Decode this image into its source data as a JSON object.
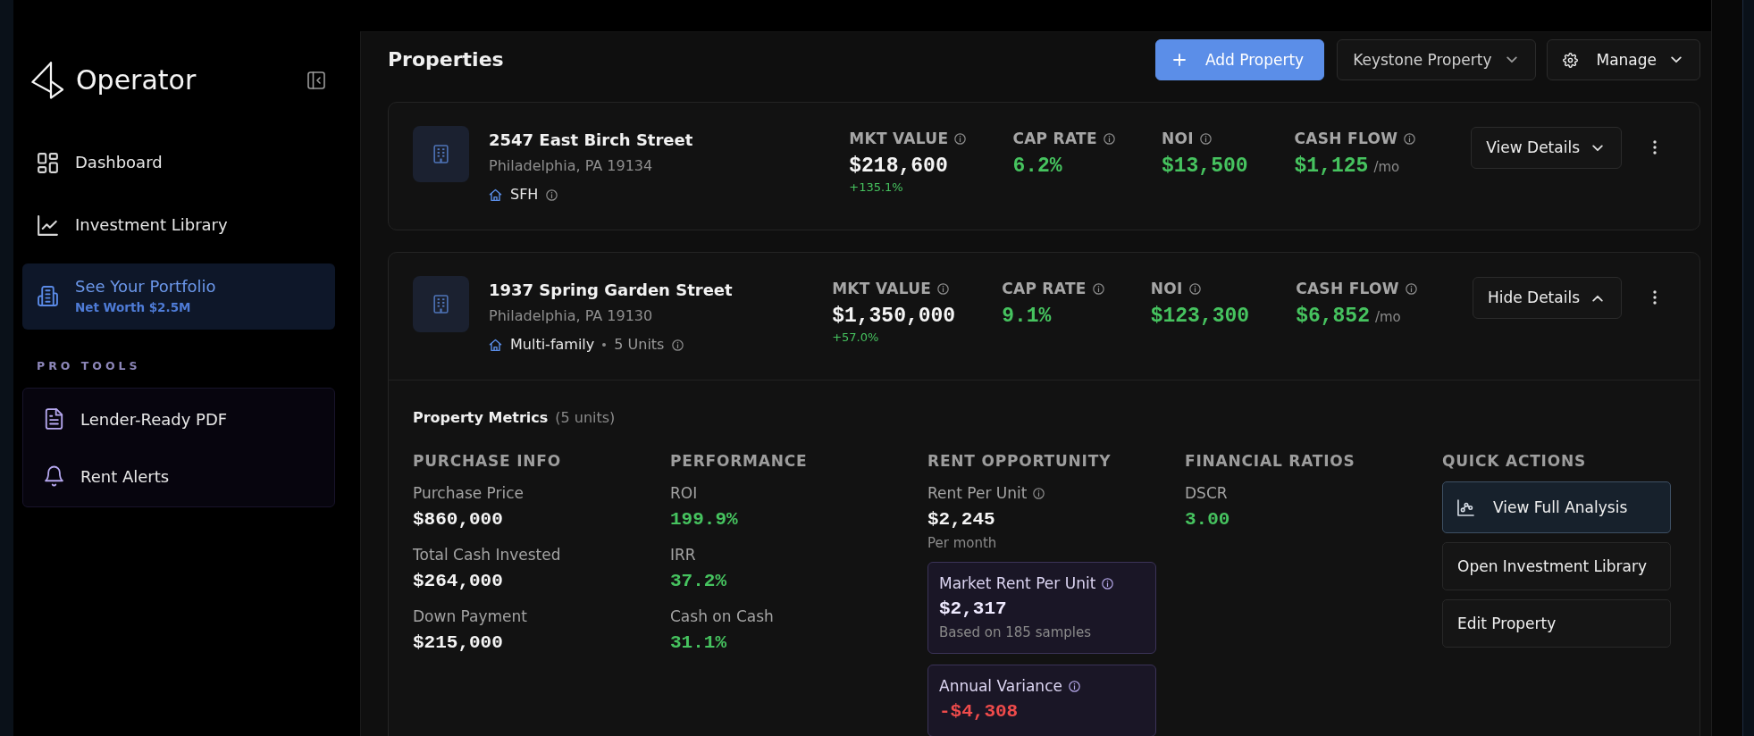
{
  "sidebar": {
    "brand": "Operator",
    "nav": [
      {
        "label": "Dashboard",
        "selected": false
      },
      {
        "label": "Investment Library",
        "selected": false
      },
      {
        "label": "See Your Portfolio",
        "subtitle": "Net Worth $2.5M",
        "selected": true
      }
    ],
    "section_title": "PRO TOOLS",
    "pro_tools": [
      {
        "label": "Lender-Ready PDF"
      },
      {
        "label": "Rent Alerts"
      }
    ]
  },
  "header": {
    "title": "Properties",
    "add_button": "Add Property",
    "portfolio_select": "Keystone Property",
    "manage_button": "Manage"
  },
  "properties": [
    {
      "address": "2547 East Birch Street",
      "city": "Philadelphia, PA 19134",
      "type": "SFH",
      "type_info": true,
      "metrics": [
        {
          "label": "MKT VALUE",
          "info": true,
          "value": "$218,600",
          "color": "#f4f4f4",
          "change": "+135.1%"
        },
        {
          "label": "CAP RATE",
          "info": true,
          "value": "6.2%",
          "color": "#46c35f"
        },
        {
          "label": "NOI",
          "info": true,
          "value": "$13,500",
          "color": "#46c35f"
        },
        {
          "label": "CASH FLOW",
          "info": true,
          "value": "$1,125",
          "color": "#46c35f",
          "suffix": "/mo"
        }
      ],
      "toggle_label": "View Details",
      "expanded": false
    },
    {
      "address": "1937 Spring Garden Street",
      "city": "Philadelphia, PA 19130",
      "type": "Multi-family",
      "units": "5 Units",
      "type_info": true,
      "metrics": [
        {
          "label": "MKT VALUE",
          "info": true,
          "value": "$1,350,000",
          "color": "#f4f4f4",
          "change": "+57.0%"
        },
        {
          "label": "CAP RATE",
          "info": true,
          "value": "9.1%",
          "color": "#46c35f"
        },
        {
          "label": "NOI",
          "info": true,
          "value": "$123,300",
          "color": "#46c35f"
        },
        {
          "label": "CASH FLOW",
          "info": true,
          "value": "$6,852",
          "color": "#46c35f",
          "suffix": "/mo"
        }
      ],
      "toggle_label": "Hide Details",
      "expanded": true,
      "details": {
        "title": "Property Metrics",
        "title_note": "(5 units)",
        "sections": [
          {
            "kind": "metrics",
            "heading": "PURCHASE INFO",
            "items": [
              {
                "label": "Purchase Price",
                "value": "$860,000",
                "color": "#f4f4f4"
              },
              {
                "label": "Total Cash Invested",
                "value": "$264,000",
                "color": "#f4f4f4"
              },
              {
                "label": "Down Payment",
                "value": "$215,000",
                "color": "#f4f4f4"
              }
            ]
          },
          {
            "kind": "metrics",
            "heading": "PERFORMANCE",
            "items": [
              {
                "label": "ROI",
                "value": "199.9%",
                "color": "#46c35f"
              },
              {
                "label": "IRR",
                "value": "37.2%",
                "color": "#46c35f"
              },
              {
                "label": "Cash on Cash",
                "value": "31.1%",
                "color": "#46c35f"
              }
            ]
          },
          {
            "kind": "metrics",
            "heading": "RENT OPPORTUNITY",
            "items": [
              {
                "label": "Rent Per Unit",
                "info": true,
                "value": "$2,245",
                "color": "#f4f4f4",
                "note": "Per month"
              }
            ],
            "callouts": [
              {
                "label": "Market Rent Per Unit",
                "info": true,
                "value": "$2,317",
                "color": "#efeaff",
                "note": "Based on 185 samples"
              },
              {
                "label": "Annual Variance",
                "info": true,
                "value": "-$4,308",
                "color": "#ef4b4b"
              }
            ]
          },
          {
            "kind": "metrics",
            "heading": "FINANCIAL RATIOS",
            "items": [
              {
                "label": "DSCR",
                "value": "3.00",
                "color": "#46c35f"
              }
            ]
          },
          {
            "kind": "actions",
            "heading": "QUICK ACTIONS",
            "actions": [
              {
                "label": "View Full Analysis",
                "primary": true
              },
              {
                "label": "Open Investment Library",
                "primary": false
              },
              {
                "label": "Edit Property",
                "primary": false
              }
            ]
          }
        ]
      }
    }
  ]
}
